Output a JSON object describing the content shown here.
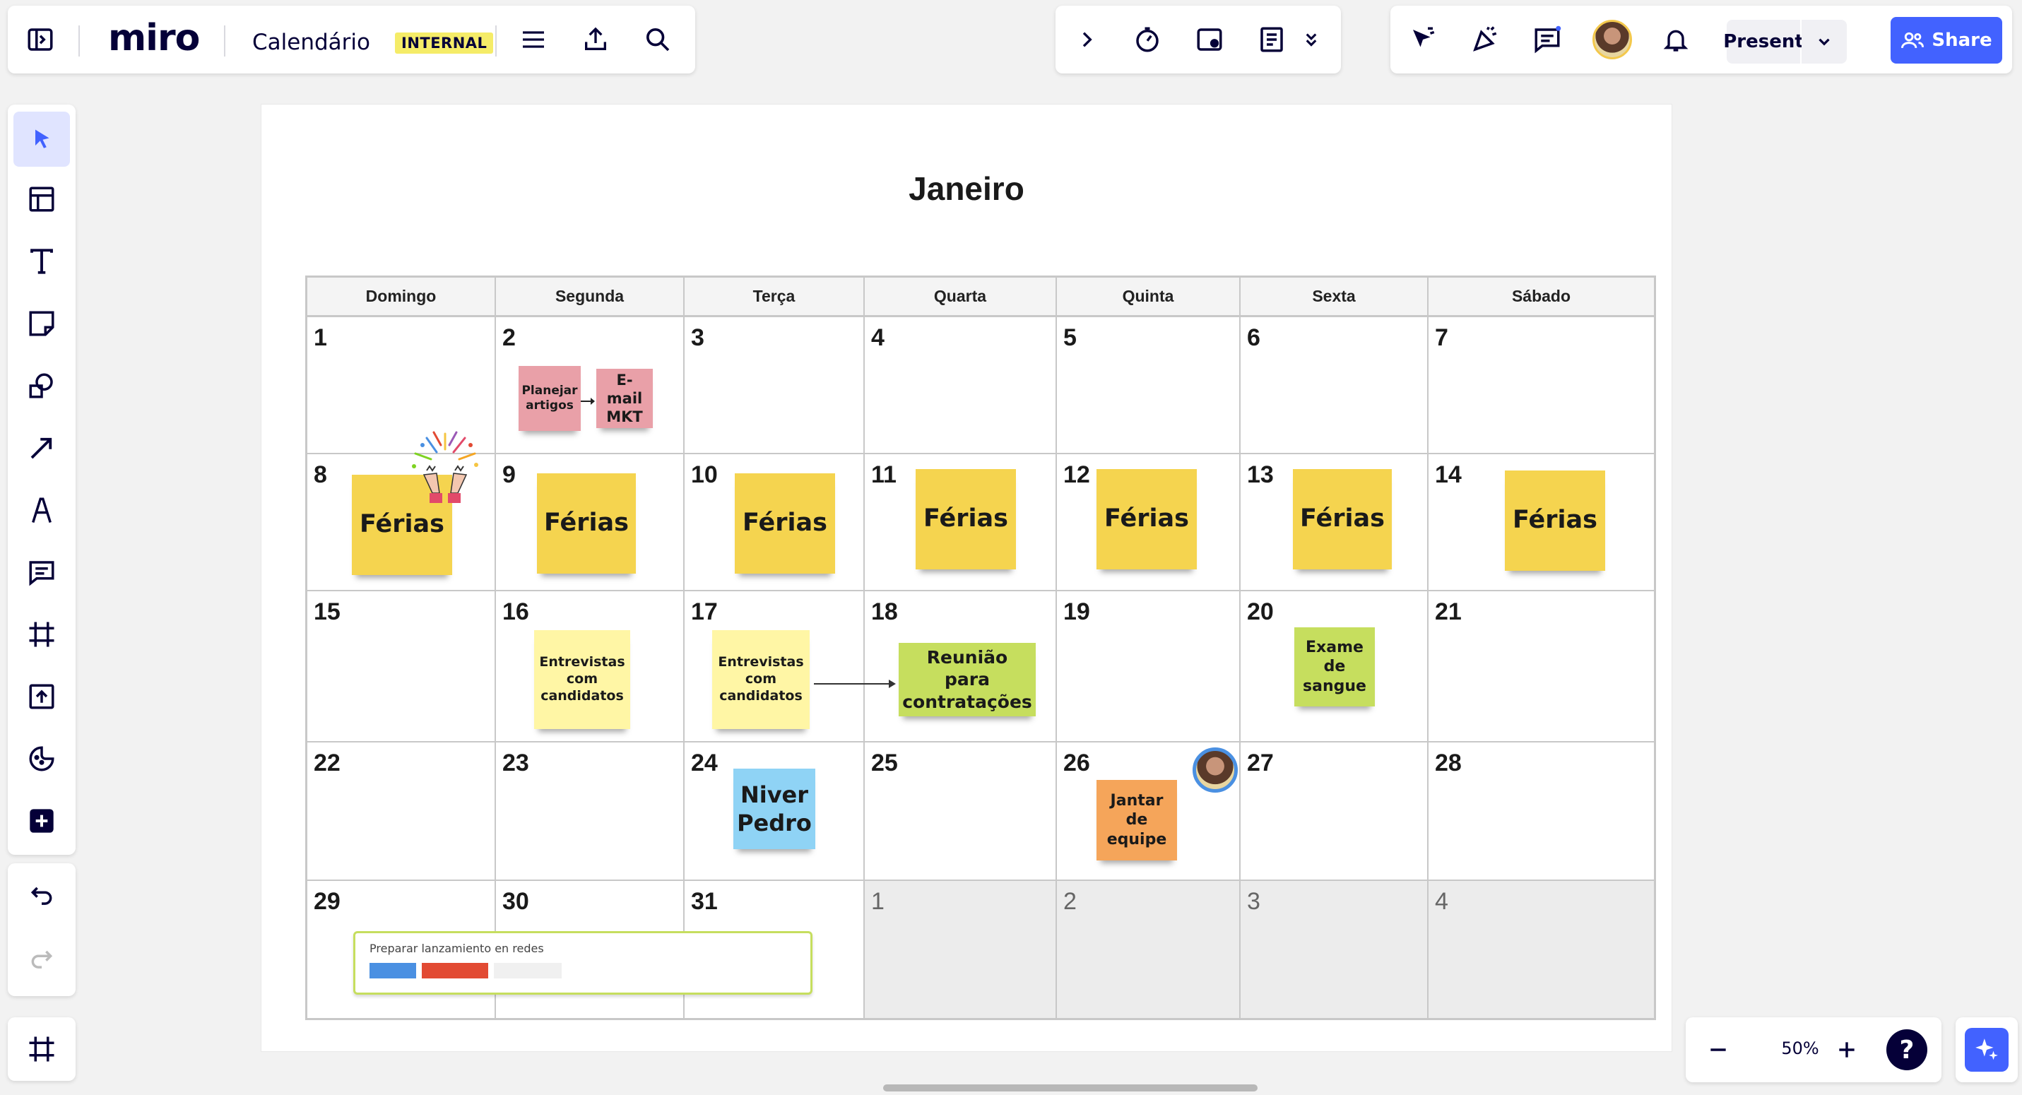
{
  "app": {
    "logo": "miro",
    "board_title": "Calendário",
    "badge": "INTERNAL"
  },
  "topright": {
    "present_label": "Present",
    "share_label": "Share"
  },
  "zoom": {
    "value": "50%"
  },
  "help": {
    "label": "?"
  },
  "calendar": {
    "title": "Janeiro",
    "weekdays": [
      "Domingo",
      "Segunda",
      "Terça",
      "Quarta",
      "Quinta",
      "Sexta",
      "Sábado"
    ],
    "weeks": [
      [
        "1",
        "2",
        "3",
        "4",
        "5",
        "6",
        "7"
      ],
      [
        "8",
        "9",
        "10",
        "11",
        "12",
        "13",
        "14"
      ],
      [
        "15",
        "16",
        "17",
        "18",
        "19",
        "20",
        "21"
      ],
      [
        "22",
        "23",
        "24",
        "25",
        "26",
        "27",
        "28"
      ],
      [
        "29",
        "30",
        "31",
        "1",
        "2",
        "3",
        "4"
      ]
    ]
  },
  "stickies": {
    "planejar": "Planejar\nartigos",
    "email": "E-mail\nMKT",
    "ferias": "Férias",
    "entrevistas": "Entrevistas\ncom\ncandidatos",
    "reuniao": "Reunião para\ncontratações",
    "exame": "Exame\nde\nsangue",
    "niver": "Niver\nPedro",
    "jantar": "Jantar\nde\nequipe"
  },
  "task_card": {
    "title": "Preparar lanzamiento en redes",
    "bar_colors": [
      "#4a90e2",
      "#e24a33",
      "#f0f0f0"
    ]
  },
  "colors": {
    "accent": "#4262ff",
    "badge": "#f5ec68"
  }
}
